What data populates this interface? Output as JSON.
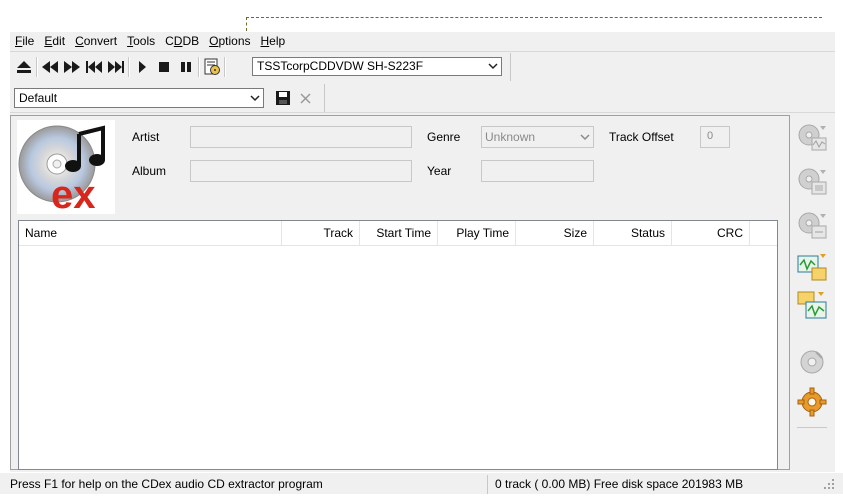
{
  "menu": [
    {
      "pre": "",
      "u": "F",
      "post": "ile"
    },
    {
      "pre": "",
      "u": "E",
      "post": "dit"
    },
    {
      "pre": "",
      "u": "C",
      "post": "onvert"
    },
    {
      "pre": "",
      "u": "T",
      "post": "ools"
    },
    {
      "pre": "C",
      "u": "D",
      "post": "DB"
    },
    {
      "pre": "",
      "u": "O",
      "post": "ptions"
    },
    {
      "pre": "",
      "u": "H",
      "post": "elp"
    }
  ],
  "toolbar": {
    "drive": "TSSTcorpCDDVDW SH-S223F",
    "profile": "Default"
  },
  "info": {
    "artist_label": "Artist",
    "album_label": "Album",
    "genre_label": "Genre",
    "genre_value": "Unknown",
    "year_label": "Year",
    "track_offset_label": "Track Offset",
    "track_offset_value": "0",
    "artist_value": "",
    "album_value": "",
    "year_value": ""
  },
  "logo_text": "ex",
  "columns": [
    "Name",
    "Track",
    "Start Time",
    "Play Time",
    "Size",
    "Status",
    "CRC"
  ],
  "status": {
    "help": "Press F1 for help on the CDex audio CD extractor program",
    "info": "0 track ( 0.00 MB) Free disk space 201983 MB"
  },
  "colors": {
    "accent_red": "#d9261c",
    "disc_silver": "#c9c9c9",
    "panel_bg": "#f0f0f0"
  },
  "icons": {
    "eject": "eject-icon",
    "prev": "rewind-icon",
    "next": "fast-forward-icon",
    "skip_back": "skip-back-icon",
    "skip_fwd": "skip-forward-icon",
    "play": "play-icon",
    "stop": "stop-icon",
    "pause": "pause-icon",
    "cddb": "cddb-icon",
    "save": "save-icon",
    "delete": "delete-icon"
  }
}
